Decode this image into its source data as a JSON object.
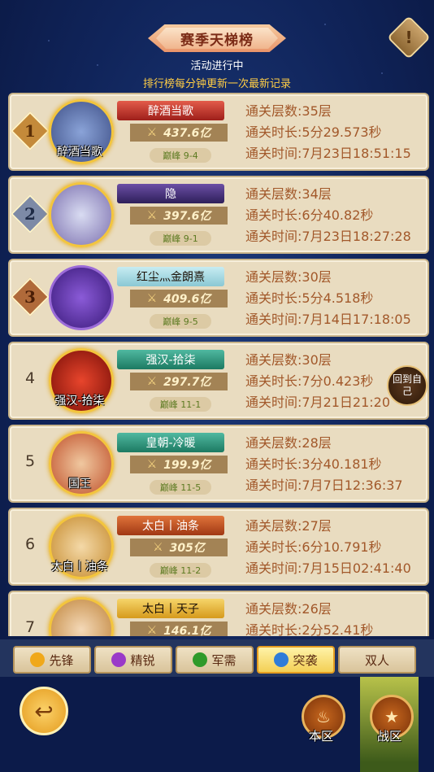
{
  "header": {
    "title": "赛季天梯榜",
    "status": "活动进行中",
    "note": "排行榜每分钟更新一次最新记录",
    "info_icon": "!"
  },
  "rows": [
    {
      "rank": "1",
      "avatar_name": "醉酒当歌",
      "player_name": "醉酒当歌",
      "power": "437.6亿",
      "tier": "巅峰 9-4",
      "floors": "通关层数:35层",
      "duration": "通关时长:5分29.573秒",
      "time": "通关时间:7月23日18:51:15"
    },
    {
      "rank": "2",
      "avatar_name": "",
      "player_name": "隐",
      "power": "397.6亿",
      "tier": "巅峰 9-1",
      "floors": "通关层数:34层",
      "duration": "通关时长:6分40.82秒",
      "time": "通关时间:7月23日18:27:28"
    },
    {
      "rank": "3",
      "avatar_name": "",
      "player_name": "红尘灬金朗熹",
      "power": "409.6亿",
      "tier": "巅峰 9-5",
      "floors": "通关层数:30层",
      "duration": "通关时长:5分4.518秒",
      "time": "通关时间:7月14日17:18:05"
    },
    {
      "rank": "4",
      "avatar_name": "强汉-拾柒",
      "player_name": "强汉-拾柒",
      "power": "297.7亿",
      "tier": "巅峰 11-1",
      "floors": "通关层数:30层",
      "duration": "通关时长:7分0.423秒",
      "time": "通关时间:7月21日21:20"
    },
    {
      "rank": "5",
      "avatar_name": "国王",
      "player_name": "皇朝-冷暖",
      "power": "199.9亿",
      "tier": "巅峰 11-5",
      "floors": "通关层数:28层",
      "duration": "通关时长:3分40.181秒",
      "time": "通关时间:7月7日12:36:37"
    },
    {
      "rank": "6",
      "avatar_name": "太白丨油条",
      "player_name": "太白丨油条",
      "power": "305亿",
      "tier": "巅峰 11-2",
      "floors": "通关层数:27层",
      "duration": "通关时长:6分10.791秒",
      "time": "通关时间:7月15日02:41:40"
    },
    {
      "rank": "7",
      "avatar_name": "",
      "player_name": "太白丨天子",
      "power": "146.1亿",
      "tier": "",
      "floors": "通关层数:26层",
      "duration": "通关时长:2分52.41秒",
      "time": ""
    }
  ],
  "back_to_me": "回到自己",
  "tabs": [
    {
      "label": "先锋",
      "icon": "shield-icon",
      "color": "#f0a81a"
    },
    {
      "label": "精锐",
      "icon": "sword-icon",
      "color": "#9a39c8"
    },
    {
      "label": "军需",
      "icon": "leaf-icon",
      "color": "#2f9a2a"
    },
    {
      "label": "突袭",
      "icon": "swirl-icon",
      "color": "#2f7cd8",
      "active": true
    },
    {
      "label": "双人",
      "icon": "",
      "color": ""
    }
  ],
  "nav": {
    "local": "本区",
    "battle_zone": "战区"
  },
  "colors": {
    "row_bg": "#e9dcc0",
    "stat_text": "#a2582a",
    "tier_text": "#5c7a21"
  }
}
